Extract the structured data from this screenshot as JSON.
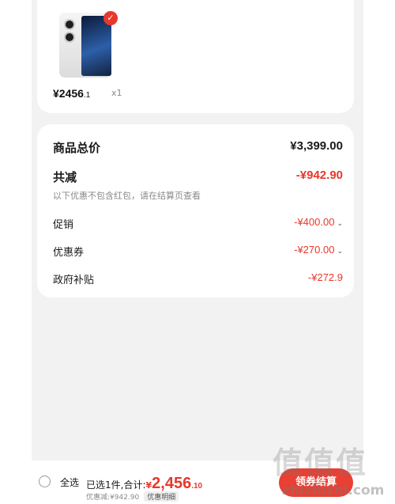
{
  "product": {
    "price_int": "¥2456",
    "price_dec": ".1",
    "quantity": "x1",
    "check_mark": "✓"
  },
  "summary": {
    "total_label": "商品总价",
    "total_value": "¥3,399.00",
    "reduce_label": "共减",
    "reduce_value": "-¥942.90",
    "note": "以下优惠不包含红包，请在结算页查看",
    "promo_label": "促销",
    "promo_value": "-¥400.00",
    "coupon_label": "优惠券",
    "coupon_value": "-¥270.00",
    "gov_label": "政府补贴",
    "gov_value": "-¥272.9",
    "chevron": "⌄"
  },
  "bottom_bar": {
    "select_all": "全选",
    "selected_prefix": "已选1件,合计:",
    "total_currency": "¥",
    "total_int": "2,456",
    "total_dec": ".10",
    "discount_text": "优惠减:¥942.90",
    "detail_label": "优惠明细",
    "checkout_label": "领券结算"
  },
  "watermark": {
    "glyphs": "值值值",
    "text": "zhizhizhi.com"
  },
  "colors": {
    "accent": "#e9372b",
    "background": "#f2f2f2"
  }
}
